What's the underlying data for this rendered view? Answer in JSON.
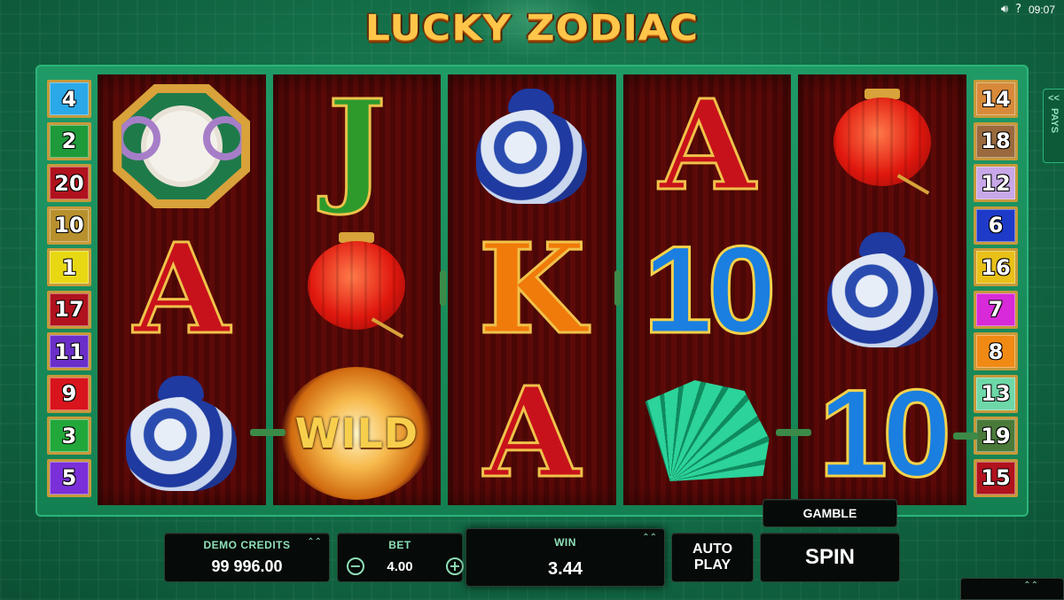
{
  "status": {
    "sound_icon": "speaker-icon",
    "help_icon": "question-icon",
    "time": "09:07"
  },
  "title": "LUCKY ZODIAC",
  "left_lines": [
    {
      "n": "4",
      "color": "#2ba8e8"
    },
    {
      "n": "2",
      "color": "#1e9a3a"
    },
    {
      "n": "20",
      "color": "#b0121e"
    },
    {
      "n": "10",
      "color": "#b8912e"
    },
    {
      "n": "1",
      "color": "#e8d813"
    },
    {
      "n": "17",
      "color": "#b0121e"
    },
    {
      "n": "11",
      "color": "#6a2fc8"
    },
    {
      "n": "9",
      "color": "#d8141c"
    },
    {
      "n": "3",
      "color": "#22a83a"
    },
    {
      "n": "5",
      "color": "#7a2fd8"
    }
  ],
  "right_lines": [
    {
      "n": "14",
      "color": "#d88a3a"
    },
    {
      "n": "18",
      "color": "#9a6a3e"
    },
    {
      "n": "12",
      "color": "#c8a8e8"
    },
    {
      "n": "6",
      "color": "#1e3ac8"
    },
    {
      "n": "16",
      "color": "#e8c018"
    },
    {
      "n": "7",
      "color": "#d82ad8"
    },
    {
      "n": "8",
      "color": "#f08a14"
    },
    {
      "n": "13",
      "color": "#6ed8a8"
    },
    {
      "n": "19",
      "color": "#4a7a3a"
    },
    {
      "n": "15",
      "color": "#b0121e"
    }
  ],
  "reels": [
    [
      "ram",
      "A",
      "vase"
    ],
    [
      "J",
      "lantern",
      "WILD"
    ],
    [
      "vase",
      "K",
      "A"
    ],
    [
      "A",
      "10",
      "fan"
    ],
    [
      "lantern",
      "vase",
      "10"
    ]
  ],
  "pays_tab": {
    "arrows": "<<",
    "label": "PAYS"
  },
  "controls": {
    "credits_label": "DEMO CREDITS",
    "credits_value": "99 996.00",
    "bet_label": "BET",
    "bet_value": "4.00",
    "bet_minus": "−",
    "bet_plus": "+",
    "win_label": "WIN",
    "win_value": "3.44",
    "autoplay_label": "AUTO\nPLAY",
    "gamble_label": "GAMBLE",
    "spin_label": "SPIN",
    "expand_arrow": "⌃⌃"
  }
}
